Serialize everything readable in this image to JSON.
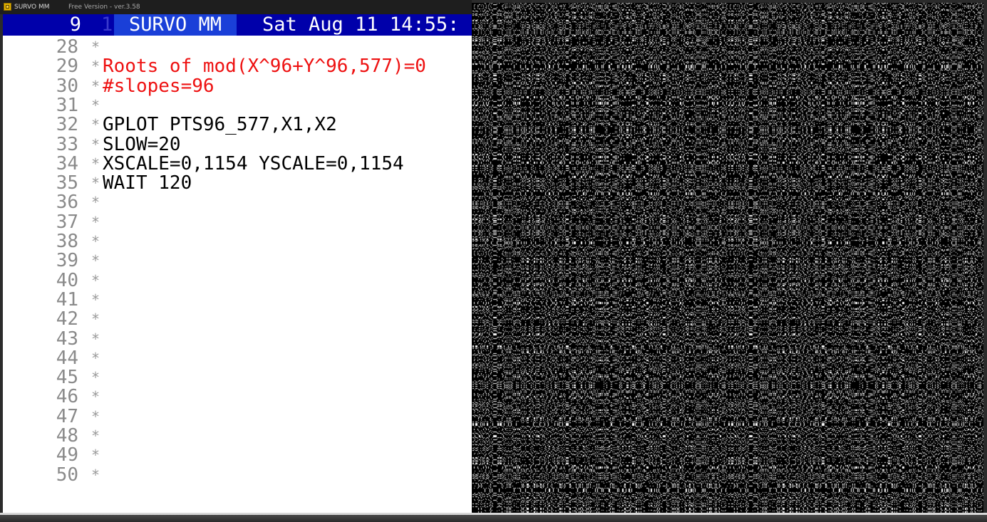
{
  "window": {
    "title": "SURVO MM",
    "version": "Free Version - ver.3.58"
  },
  "status": {
    "line_number": "9",
    "cursor_mark": "1",
    "app_name": "SURVO MM",
    "datetime": "Sat Aug 11 14:55:"
  },
  "editor": {
    "lines": [
      {
        "num": "28",
        "text": "",
        "color": "#000000"
      },
      {
        "num": "29",
        "text": "Roots of mod(X^96+Y^96,577)=0",
        "color": "#ee1111"
      },
      {
        "num": "30",
        "text": "#slopes=96",
        "color": "#ee1111"
      },
      {
        "num": "31",
        "text": "",
        "color": "#000000"
      },
      {
        "num": "32",
        "text": "GPLOT PTS96_577,X1,X2",
        "color": "#000000"
      },
      {
        "num": "33",
        "text": "SLOW=20",
        "color": "#000000"
      },
      {
        "num": "34",
        "text": "XSCALE=0,1154 YSCALE=0,1154",
        "color": "#000000"
      },
      {
        "num": "35",
        "text": "WAIT 120",
        "color": "#000000"
      },
      {
        "num": "36",
        "text": "",
        "color": "#000000"
      },
      {
        "num": "37",
        "text": "",
        "color": "#000000"
      },
      {
        "num": "38",
        "text": "",
        "color": "#000000"
      },
      {
        "num": "39",
        "text": "",
        "color": "#000000"
      },
      {
        "num": "40",
        "text": "",
        "color": "#000000"
      },
      {
        "num": "41",
        "text": "",
        "color": "#000000"
      },
      {
        "num": "42",
        "text": "",
        "color": "#000000"
      },
      {
        "num": "43",
        "text": "",
        "color": "#000000"
      },
      {
        "num": "44",
        "text": "",
        "color": "#000000"
      },
      {
        "num": "45",
        "text": "",
        "color": "#000000"
      },
      {
        "num": "46",
        "text": "",
        "color": "#000000"
      },
      {
        "num": "47",
        "text": "",
        "color": "#000000"
      },
      {
        "num": "48",
        "text": "",
        "color": "#000000"
      },
      {
        "num": "49",
        "text": "",
        "color": "#000000"
      },
      {
        "num": "50",
        "text": "",
        "color": "#000000"
      }
    ],
    "control_char": "*"
  },
  "plot": {
    "modulus": 577,
    "exponent": 96,
    "xscale": [
      0,
      1154
    ],
    "yscale": [
      0,
      1154
    ],
    "background": "#000000",
    "point_color": "#ffffff"
  },
  "colors": {
    "status_bg": "#0000aa",
    "status_app_bg": "#1a3fd8",
    "editor_bg": "#ffffff",
    "line_number": "#8a8a8a",
    "highlight_text": "#ee1111"
  }
}
